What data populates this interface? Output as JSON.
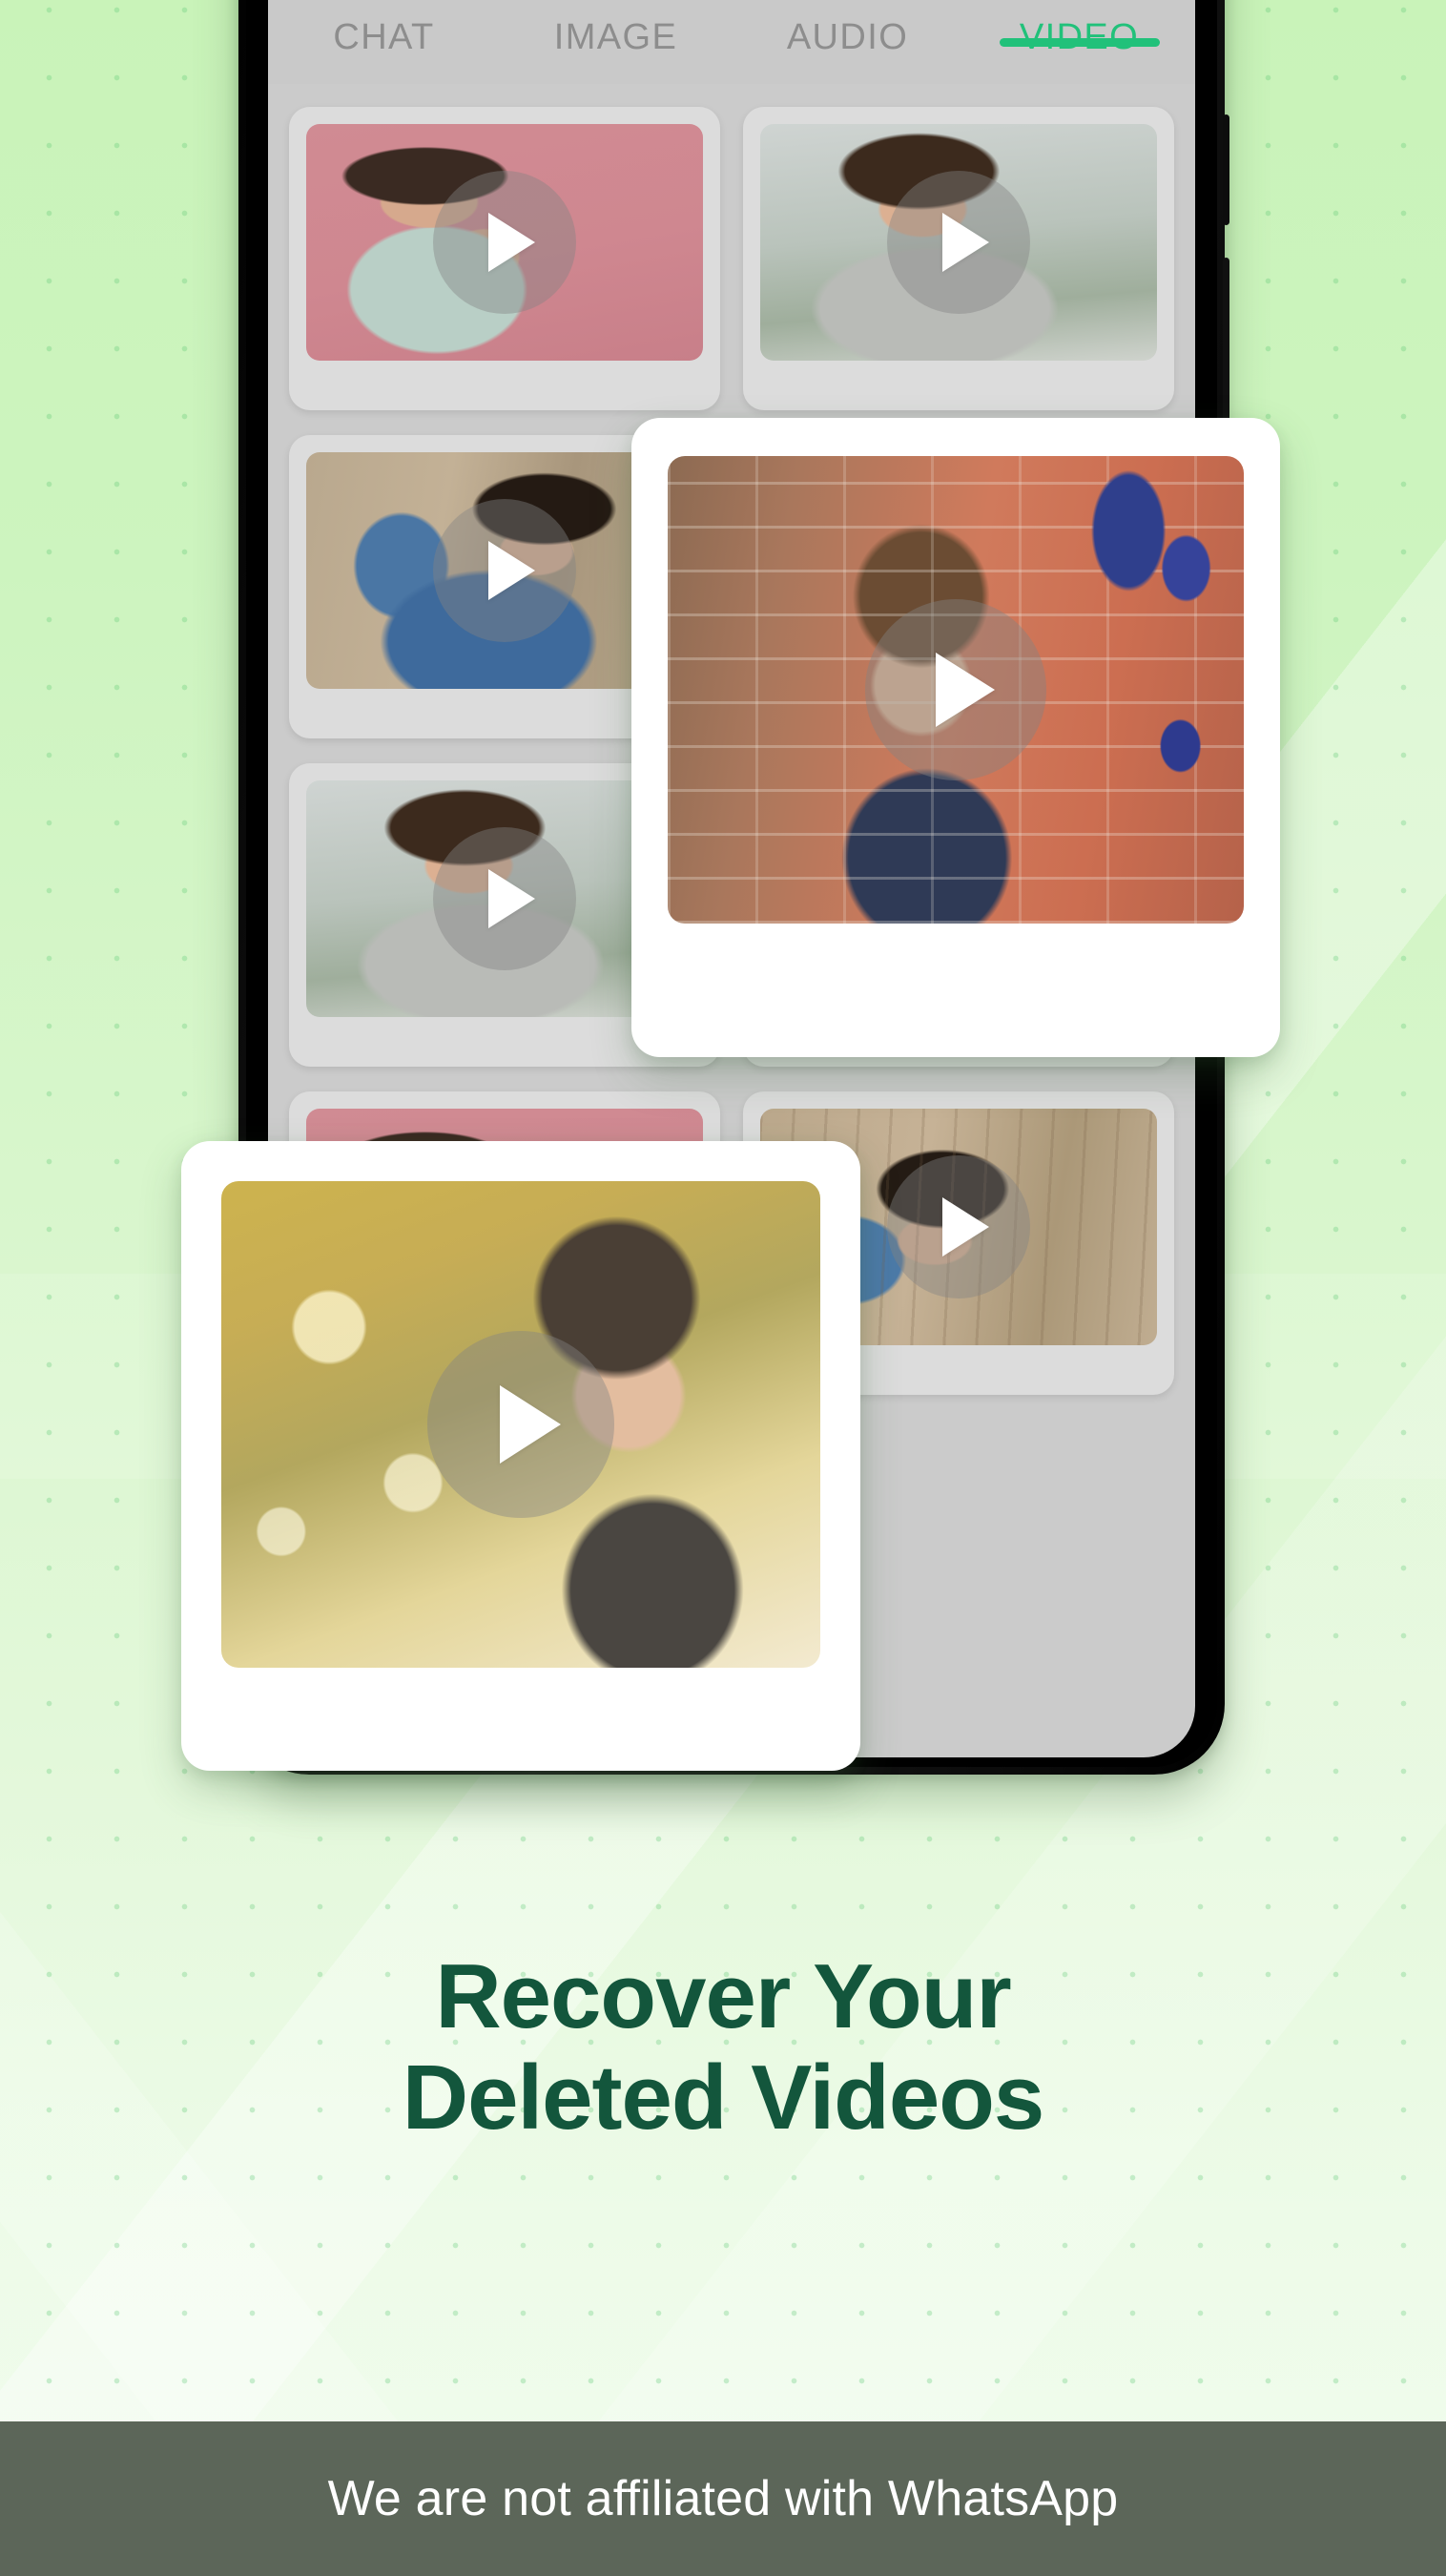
{
  "background": {
    "gradient_top": "#c9f3b9",
    "gradient_bottom": "#f1fcee",
    "dot_color": "#56c66e"
  },
  "phone": {
    "frame_color": "#000000",
    "screen_background": "#cbcbcb",
    "buttons": [
      {
        "name": "power-button"
      },
      {
        "name": "volume-button"
      }
    ]
  },
  "app": {
    "accent_color": "#21c17a",
    "inactive_tab_color": "#8d8d8d",
    "tabs": [
      {
        "label": "CHAT",
        "active": false
      },
      {
        "label": "IMAGE",
        "active": false
      },
      {
        "label": "AUDIO",
        "active": false
      },
      {
        "label": "VIDEO",
        "active": true
      }
    ],
    "grid_cards": [
      {
        "icon": "play-icon",
        "thumbnail": "man-thinking-pink-background"
      },
      {
        "icon": "play-icon",
        "thumbnail": "curly-haired-man-smiling-outdoors"
      },
      {
        "icon": "play-icon",
        "thumbnail": "man-denim-shirt-glasses-wood-wall"
      },
      {
        "icon": "play-icon",
        "thumbnail": "man-dark-hair-partial"
      },
      {
        "icon": "play-icon",
        "thumbnail": "man-plaid-shirt-grey-wall"
      },
      {
        "icon": "play-icon",
        "thumbnail": "man-denim-shirt-glasses-wood-wall"
      }
    ]
  },
  "floating_cards": [
    {
      "icon": "play-icon",
      "thumbnail": "man-glasses-brick-graffiti-wall",
      "card_background": "#ffffff"
    },
    {
      "icon": "play-icon",
      "thumbnail": "mature-man-smiling-autumn-park",
      "card_background": "#ffffff"
    }
  ],
  "headline": {
    "line1": "Recover Your",
    "line2": "Deleted Videos",
    "color": "#13563c"
  },
  "footer": {
    "disclaimer": "We are not affiliated with WhatsApp",
    "background": "#5c6659",
    "text_color": "#ffffff"
  }
}
